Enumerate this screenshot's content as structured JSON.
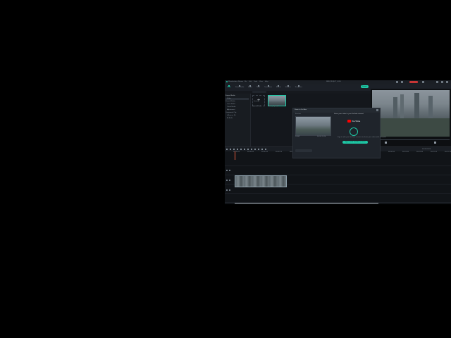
{
  "app": {
    "title": "Wondershare Filmora",
    "project_name": "NEW_PROJECT_2024",
    "export_label": "Export",
    "menu": [
      "File",
      "Edit",
      "Tools",
      "View",
      "Help"
    ],
    "toolbar_tabs": [
      "Media",
      "Stock Media",
      "Audio",
      "Titles",
      "Transitions",
      "Effects",
      "Stickers",
      "Templates"
    ]
  },
  "left_panel": {
    "items": [
      "Project Media",
      "Folder",
      "Shared Media",
      "Local Media",
      "Cloud Media",
      "Adjustment",
      "Compound Clip",
      "Influence Kit",
      "AI Audio"
    ]
  },
  "media": {
    "import_label": "Import Media",
    "clip_name": "drone_city.mp4",
    "search_placeholder": "Search"
  },
  "dialog": {
    "title": "Share to YouTube",
    "subtitle": "Preview",
    "youtube_label": "YouTube",
    "headline": "Share your video to your YouTube channel",
    "body": "Sign in with your YouTube account to share your video with everyone",
    "signin_button": "Sign in with YouTube account",
    "resolution_label": "1080P",
    "duration_label": "00:00:12:24"
  },
  "timeline": {
    "timecode": "00:00:00:00",
    "ruler_marks": [
      "00:00:00",
      "00:00:05",
      "00:00:10",
      "00:00:15",
      "00:00:20",
      "00:00:25",
      "00:00:30",
      "00:00:35",
      "00:00:40",
      "00:00:45",
      "00:00:50",
      "00:00:55",
      "00:01:00",
      "00:01:05",
      "00:01:10",
      "00:01:15"
    ]
  },
  "colors": {
    "accent": "#1fc8a6",
    "youtube_red": "#ff0000",
    "background": "#16191e"
  }
}
